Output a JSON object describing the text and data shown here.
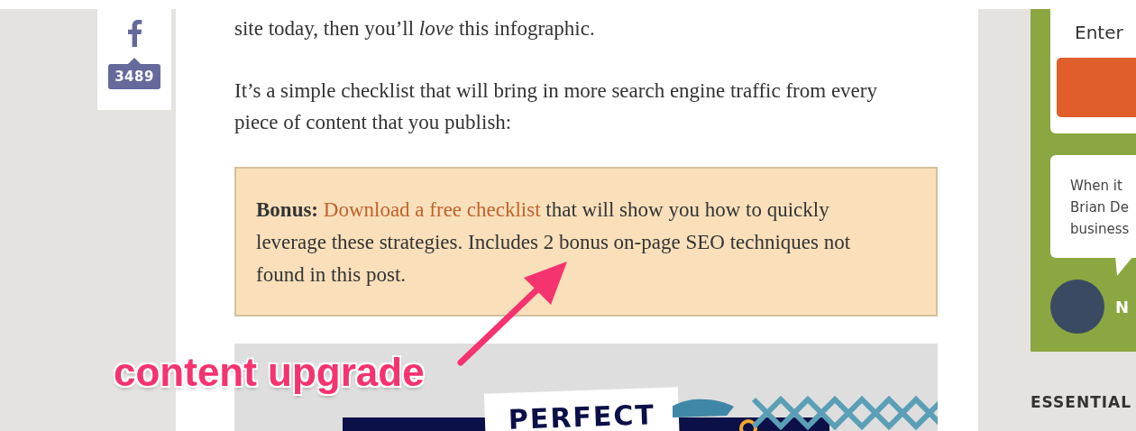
{
  "share": {
    "count": "3489"
  },
  "article": {
    "paragraphs": [
      "site today, then you’ll *love* this infographic.",
      "It’s a simple checklist that will bring in more search engine traffic from every piece of content that you publish:"
    ],
    "bonus": {
      "label": "Bonus:",
      "link": "Download a free checklist",
      "text": "that will show you how to quickly leverage these strategies. Includes 2 bonus on-page SEO techniques not found in this post."
    },
    "infographic": {
      "title": "PERFECT"
    }
  },
  "annotation": {
    "text": "content upgrade"
  },
  "sidebar": {
    "optin": {
      "prompt": "Enter"
    },
    "testimonial": {
      "lines": [
        "When it",
        "Brian De",
        "business"
      ],
      "author": "N"
    },
    "heading": "ESSENTIAL"
  }
}
